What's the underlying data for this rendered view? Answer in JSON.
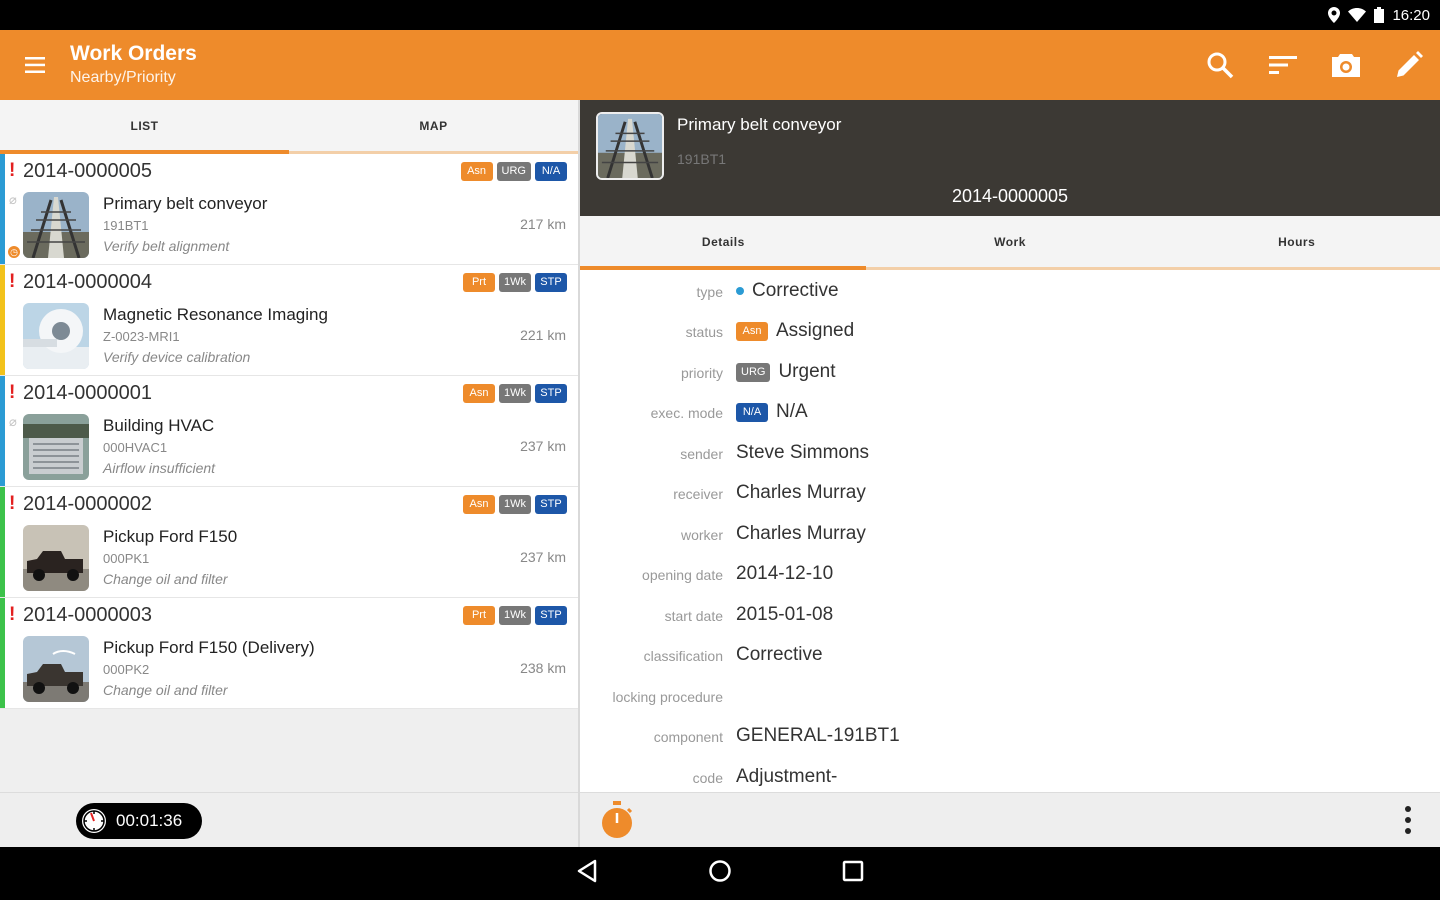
{
  "status_bar": {
    "time": "16:20"
  },
  "app_bar": {
    "title": "Work Orders",
    "subtitle": "Nearby/Priority",
    "actions": [
      "search-icon",
      "sort-icon",
      "camera-icon",
      "edit-icon"
    ]
  },
  "left_tabs": {
    "list": "LIST",
    "map": "MAP"
  },
  "work_orders": [
    {
      "code": "2014-0000005",
      "badges": [
        "Asn",
        "URG",
        "N/A"
      ],
      "name": "Primary belt conveyor",
      "ident": "191BT1",
      "note": "Verify belt alignment",
      "distance": "217 km",
      "strip_color": "#2b9bd4",
      "thumb": "conveyor"
    },
    {
      "code": "2014-0000004",
      "badges": [
        "Prt",
        "1Wk",
        "STP"
      ],
      "name": "Magnetic Resonance Imaging",
      "ident": "Z-0023-MRI1",
      "note": "Verify device calibration",
      "distance": "221 km",
      "strip_color": "#f2c21b",
      "thumb": "mri"
    },
    {
      "code": "2014-0000001",
      "badges": [
        "Asn",
        "1Wk",
        "STP"
      ],
      "name": "Building HVAC",
      "ident": "000HVAC1",
      "note": "Airflow insufficient",
      "distance": "237 km",
      "strip_color": "#2b9bd4",
      "thumb": "hvac"
    },
    {
      "code": "2014-0000002",
      "badges": [
        "Asn",
        "1Wk",
        "STP"
      ],
      "name": "Pickup Ford F150",
      "ident": "000PK1",
      "note": "Change oil and filter",
      "distance": "237 km",
      "strip_color": "#3cc24a",
      "thumb": "truck"
    },
    {
      "code": "2014-0000003",
      "badges": [
        "Prt",
        "1Wk",
        "STP"
      ],
      "name": "Pickup Ford F150 (Delivery)",
      "ident": "000PK2",
      "note": "Change oil and filter",
      "distance": "238 km",
      "strip_color": "#3cc24a",
      "thumb": "truck2"
    }
  ],
  "timer": {
    "value": "00:01:36"
  },
  "detail": {
    "title": "Primary belt conveyor",
    "ident": "191BT1",
    "code": "2014-0000005",
    "tabs": [
      "Details",
      "Work",
      "Hours"
    ],
    "fields": [
      {
        "label": "type",
        "value": "Corrective",
        "badge": "",
        "bullet": true
      },
      {
        "label": "status",
        "value": "Assigned",
        "badge": "Asn",
        "badge_color": "orange"
      },
      {
        "label": "priority",
        "value": "Urgent",
        "badge": "URG",
        "badge_color": "gray"
      },
      {
        "label": "exec. mode",
        "value": "N/A",
        "badge": "N/A",
        "badge_color": "blue"
      },
      {
        "label": "sender",
        "value": "Steve Simmons",
        "badge": ""
      },
      {
        "label": "receiver",
        "value": "Charles Murray",
        "badge": ""
      },
      {
        "label": "worker",
        "value": "Charles Murray",
        "badge": ""
      },
      {
        "label": "opening date",
        "value": "2014-12-10",
        "badge": ""
      },
      {
        "label": "start date",
        "value": "2015-01-08",
        "badge": ""
      },
      {
        "label": "classification",
        "value": "Corrective",
        "badge": ""
      },
      {
        "label": "locking procedure",
        "value": "",
        "badge": ""
      },
      {
        "label": "component",
        "value": "GENERAL-191BT1",
        "badge": ""
      },
      {
        "label": "code",
        "value": "Adjustment-",
        "badge": ""
      }
    ]
  },
  "colors": {
    "accent": "#ee8b2b",
    "header_dark": "#3c3934",
    "badge_blue": "#1d57a8",
    "badge_gray": "#777777"
  }
}
